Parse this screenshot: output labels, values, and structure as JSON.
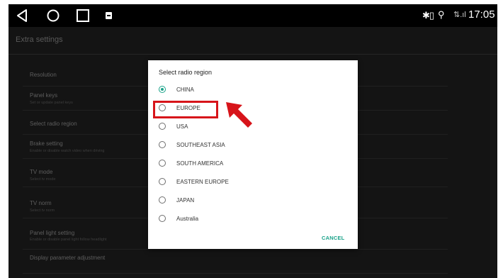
{
  "status_bar": {
    "icons": {
      "back": "back-triangle-icon",
      "home": "home-circle-icon",
      "recent": "recent-apps-square-icon",
      "media": "media-card-icon",
      "bluetooth": "bluetooth-battery-icon",
      "location": "location-pin-icon",
      "signal": "signal-icon"
    },
    "bt_glyph": "✱▯",
    "loc_glyph": "⚲",
    "signal_glyph": "⇅.ıl",
    "time": "17:05"
  },
  "background": {
    "title": "Extra settings",
    "settings": [
      {
        "title": "Resolution",
        "subtitle": ""
      },
      {
        "title": "Panel keys",
        "subtitle": "Set or update panel keys"
      },
      {
        "title": "Select radio region",
        "subtitle": ""
      },
      {
        "title": "Brake setting",
        "subtitle": "Enable or disable watch video when driving"
      },
      {
        "title": "TV mode",
        "subtitle": "Select tv mode"
      },
      {
        "title": "TV norm",
        "subtitle": "Select tv norm"
      },
      {
        "title": "Panel light setting",
        "subtitle": "Enable or disable panel light follow headlight"
      },
      {
        "title": "Display parameter adjustment",
        "subtitle": ""
      }
    ]
  },
  "dialog": {
    "title": "Select radio region",
    "selected": "CHINA",
    "options": [
      {
        "label": "CHINA",
        "checked": true
      },
      {
        "label": "EUROPE",
        "checked": false
      },
      {
        "label": "USA",
        "checked": false
      },
      {
        "label": "SOUTHEAST ASIA",
        "checked": false
      },
      {
        "label": "SOUTH AMERICA",
        "checked": false
      },
      {
        "label": "EASTERN EUROPE",
        "checked": false
      },
      {
        "label": "JAPAN",
        "checked": false
      },
      {
        "label": "Australia",
        "checked": false
      }
    ],
    "cancel_label": "CANCEL"
  },
  "colors": {
    "accent": "#1ba38a",
    "annotation": "#d7141a",
    "status_bar": "#000000",
    "scrim_background": "#141414"
  },
  "annotation": {
    "highlighted_option": "EUROPE",
    "arrow_icon": "red-pointer-arrow-icon"
  }
}
